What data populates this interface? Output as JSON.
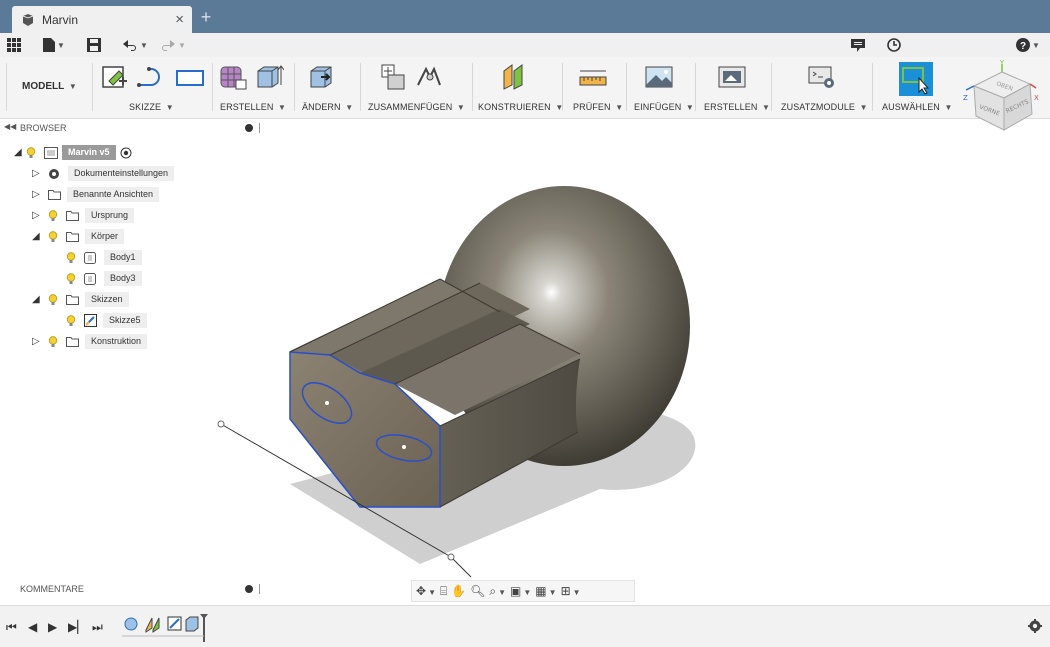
{
  "tab": {
    "title": "Marvin",
    "close": "×",
    "add": "+"
  },
  "toolbar": {
    "modell": "MODELL",
    "groups": [
      {
        "label": "SKIZZE"
      },
      {
        "label": "ERSTELLEN"
      },
      {
        "label": "ÄNDERN"
      },
      {
        "label": "ZUSAMMENFÜGEN"
      },
      {
        "label": "KONSTRUIEREN"
      },
      {
        "label": "PRÜFEN"
      },
      {
        "label": "EINFÜGEN"
      },
      {
        "label": "ERSTELLEN"
      },
      {
        "label": "ZUSATZMODULE"
      },
      {
        "label": "AUSWÄHLEN"
      }
    ]
  },
  "viewcube": {
    "top": "OBEN",
    "front": "VORNE",
    "right": "RECHTS",
    "axis_x": "X",
    "axis_y": "Y",
    "axis_z": "Z"
  },
  "browser": {
    "title": "BROWSER",
    "root": "Marvin v5",
    "items": [
      {
        "label": "Dokumenteinstellungen"
      },
      {
        "label": "Benannte Ansichten"
      },
      {
        "label": "Ursprung"
      },
      {
        "label": "Körper"
      },
      {
        "label": "Body1"
      },
      {
        "label": "Body3"
      },
      {
        "label": "Skizzen"
      },
      {
        "label": "Skizze5"
      },
      {
        "label": "Konstruktion"
      }
    ]
  },
  "comments": {
    "title": "KOMMENTARE"
  },
  "colors": {
    "titlebar": "#5b7a98",
    "accent": "#1b8fd8",
    "edge": "#2a4fc9"
  }
}
